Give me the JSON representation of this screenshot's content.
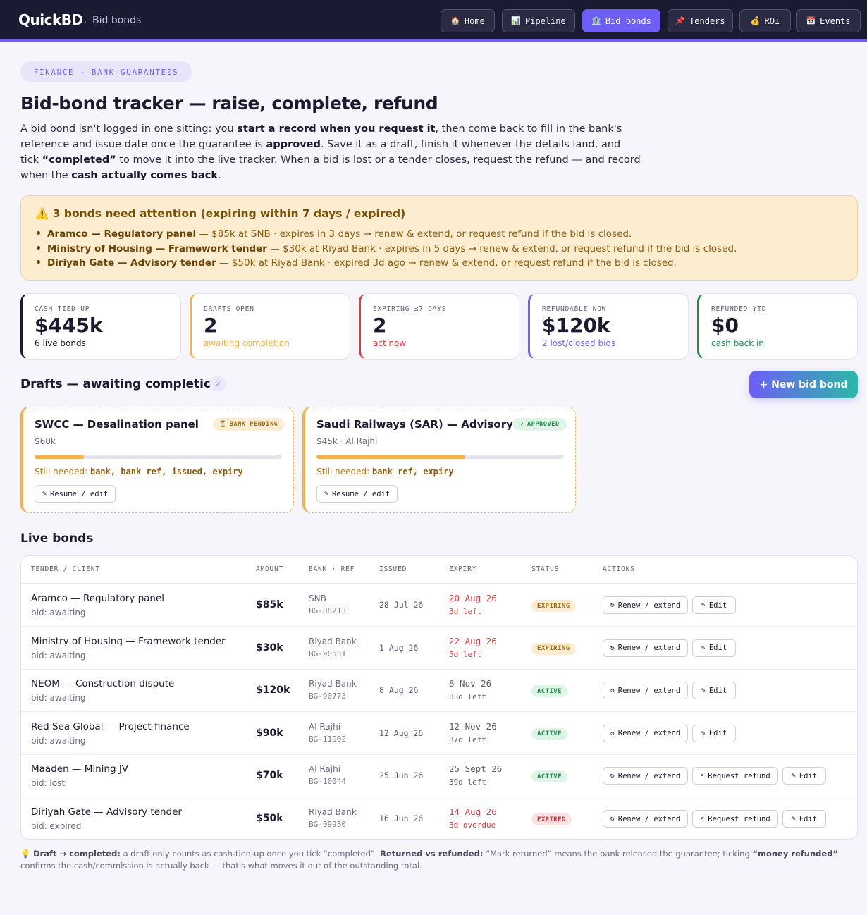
{
  "app": {
    "brand": "QuickBD",
    "separator": ".",
    "section": "Bid bonds"
  },
  "nav": [
    {
      "label": "Home",
      "icon": "house-icon",
      "glyph": "🏠",
      "active": false
    },
    {
      "label": "Pipeline",
      "icon": "chart-icon",
      "glyph": "📊",
      "active": false
    },
    {
      "label": "Bid bonds",
      "icon": "bank-icon",
      "glyph": "🏦",
      "active": true
    },
    {
      "label": "Tenders",
      "icon": "pin-icon",
      "glyph": "📌",
      "active": false
    },
    {
      "label": "ROI",
      "icon": "money-bag-icon",
      "glyph": "💰",
      "active": false
    },
    {
      "label": "Events",
      "icon": "calendar-icon",
      "glyph": "📅",
      "active": false
    }
  ],
  "header": {
    "pill": "FINANCE · BANK GUARANTEES",
    "title": "Bid-bond tracker — raise, complete, refund",
    "intro": {
      "t1": "A bid bond isn't logged in one sitting: you ",
      "b1": "start a record when you request it",
      "t2": ", then come back to fill in the bank's reference and issue date once the guarantee is ",
      "b2": "approved",
      "t3": ". Save it as a draft, finish it whenever the details land, and tick ",
      "b3": "“completed”",
      "t4": " to move it into the live tracker. When a bid is lost or a tender closes, request the refund — and record when the ",
      "b4": "cash actually comes back",
      "t5": "."
    }
  },
  "alert": {
    "icon": "warning-icon",
    "title": "3 bonds need attention (expiring within 7 days / expired)",
    "items": [
      {
        "name": "Aramco — Regulatory panel",
        "detail": " — $85k at SNB · expires in 3 days → renew & extend, or request refund if the bid is closed."
      },
      {
        "name": "Ministry of Housing — Framework tender",
        "detail": " — $30k at Riyad Bank · expires in 5 days → renew & extend, or request refund if the bid is closed."
      },
      {
        "name": "Diriyah Gate — Advisory tender",
        "detail": " — $50k at Riyad Bank · expired 3d ago → renew & extend, or request refund if the bid is closed."
      }
    ]
  },
  "stats": [
    {
      "label": "CASH TIED UP",
      "value": "$445k",
      "sub": "6 live bonds",
      "color": "#1b1a2e"
    },
    {
      "label": "DRAFTS OPEN",
      "value": "2",
      "sub": "awaiting completion",
      "color": "#f2b34c"
    },
    {
      "label": "EXPIRING ≤7 DAYS",
      "value": "2",
      "sub": "act now",
      "color": "#d64045"
    },
    {
      "label": "REFUNDABLE NOW",
      "value": "$120k",
      "sub": "2 lost/closed bids",
      "color": "#6d5ef6"
    },
    {
      "label": "REFUNDED YTD",
      "value": "$0",
      "sub": "cash back in",
      "color": "#1f8a4c"
    }
  ],
  "drafts": {
    "title": "Drafts — awaiting completion",
    "count": "2",
    "new_button": "+ New bid bond",
    "items": [
      {
        "title": "SWCC — Desalination panel",
        "tag": "BANK PENDING",
        "tag_icon": "⏳",
        "tag_kind": "pending",
        "meta": "$60k",
        "progress": 0.2,
        "need_label": "Still needed: ",
        "need": "bank, bank ref, issued, expiry",
        "button": "Resume / edit"
      },
      {
        "title": "Saudi Railways (SAR) — Advisory",
        "tag": "APPROVED",
        "tag_icon": "✓",
        "tag_kind": "approved",
        "meta": "$45k · Al Rajhi",
        "progress": 0.6,
        "need_label": "Still needed: ",
        "need": "bank ref, expiry",
        "button": "Resume / edit"
      }
    ]
  },
  "live": {
    "title": "Live bonds",
    "columns": [
      "TENDER / CLIENT",
      "AMOUNT",
      "BANK · REF",
      "ISSUED",
      "EXPIRY",
      "STATUS",
      "ACTIONS"
    ],
    "rows": [
      {
        "tender": "Aramco — Regulatory panel",
        "bid": "bid: awaiting",
        "amount": "$85k",
        "bank": "SNB",
        "ref": "BG-88213",
        "issued": "28 Jul 26",
        "expiry": "20 Aug 26",
        "left": "3d left",
        "urgent": true,
        "status": "EXPIRING",
        "status_kind": "expiring",
        "actions": [
          "Renew / extend",
          "Edit"
        ]
      },
      {
        "tender": "Ministry of Housing — Framework tender",
        "bid": "bid: awaiting",
        "amount": "$30k",
        "bank": "Riyad Bank",
        "ref": "BG-90551",
        "issued": "1 Aug 26",
        "expiry": "22 Aug 26",
        "left": "5d left",
        "urgent": true,
        "status": "EXPIRING",
        "status_kind": "expiring",
        "actions": [
          "Renew / extend",
          "Edit"
        ]
      },
      {
        "tender": "NEOM — Construction dispute",
        "bid": "bid: awaiting",
        "amount": "$120k",
        "bank": "Riyad Bank",
        "ref": "BG-90773",
        "issued": "8 Aug 26",
        "expiry": "8 Nov 26",
        "left": "83d left",
        "urgent": false,
        "status": "ACTIVE",
        "status_kind": "active",
        "actions": [
          "Renew / extend",
          "Edit"
        ]
      },
      {
        "tender": "Red Sea Global — Project finance",
        "bid": "bid: awaiting",
        "amount": "$90k",
        "bank": "Al Rajhi",
        "ref": "BG-11902",
        "issued": "12 Aug 26",
        "expiry": "12 Nov 26",
        "left": "87d left",
        "urgent": false,
        "status": "ACTIVE",
        "status_kind": "active",
        "actions": [
          "Renew / extend",
          "Edit"
        ]
      },
      {
        "tender": "Maaden — Mining JV",
        "bid": "bid: lost",
        "amount": "$70k",
        "bank": "Al Rajhi",
        "ref": "BG-10044",
        "issued": "25 Jun 26",
        "expiry": "25 Sept 26",
        "left": "39d left",
        "urgent": false,
        "status": "ACTIVE",
        "status_kind": "active",
        "actions": [
          "Renew / extend",
          "Request refund",
          "Edit"
        ]
      },
      {
        "tender": "Diriyah Gate — Advisory tender",
        "bid": "bid: expired",
        "amount": "$50k",
        "bank": "Riyad Bank",
        "ref": "BG-09980",
        "issued": "16 Jun 26",
        "expiry": "14 Aug 26",
        "left": "3d overdue",
        "urgent": true,
        "status": "EXPIRED",
        "status_kind": "expired",
        "actions": [
          "Renew / extend",
          "Request refund",
          "Edit"
        ]
      }
    ]
  },
  "footnote": {
    "icon": "lightbulb-icon",
    "b1": "Draft → completed:",
    "t1": " a draft only counts as cash-tied-up once you tick “completed”. ",
    "b2": "Returned vs refunded:",
    "t2": " “Mark returned” means the bank released the guarantee; ticking ",
    "b3": "“money refunded”",
    "t3": " confirms the cash/commission is actually back — that's what moves it out of the outstanding total."
  }
}
